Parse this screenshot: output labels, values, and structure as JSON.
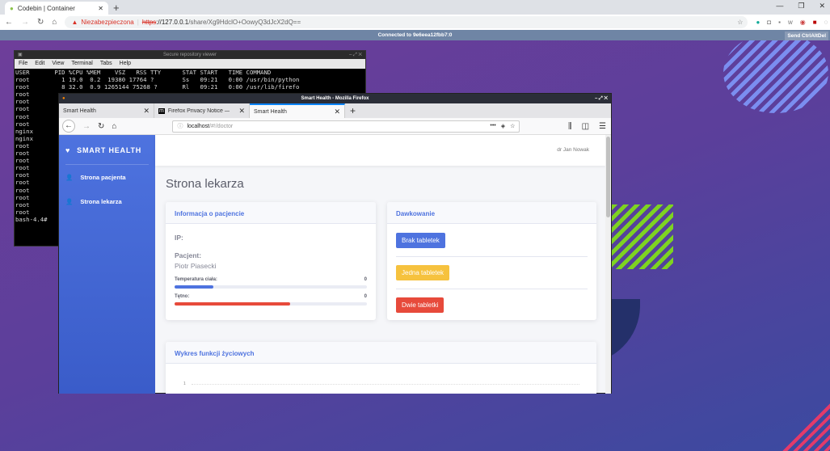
{
  "browser": {
    "tab_title": "Codebin | Container",
    "warning": "Niezabezpieczona",
    "url_scheme": "https",
    "url_host": "://127.0.0.1",
    "url_path": "/share/Xg9HdclO+OowyQ3dJcX2dQ=="
  },
  "vnc": {
    "status": "Connected to 9e6eea12fbb7:0",
    "cad_button": "Send CtrlAltDel"
  },
  "terminal": {
    "title": "Secure repository viewer",
    "menu": [
      "File",
      "Edit",
      "View",
      "Terminal",
      "Tabs",
      "Help"
    ],
    "lines": [
      "USER       PID %CPU %MEM    VSZ   RSS TTY      STAT START   TIME COMMAND",
      "root         1 19.0  0.2  19380 17764 ?        Ss   09:21   0:00 /usr/bin/python",
      "root         8 32.0  0.9 1265144 75268 ?       Rl   09:21   0:00 /usr/lib/firefo",
      "root",
      "root",
      "root",
      "root",
      "root",
      "nginx",
      "nginx",
      "root",
      "root",
      "root",
      "root",
      "root",
      "root",
      "root",
      "root",
      "root",
      "root",
      "bash-4.4# "
    ]
  },
  "firefox": {
    "title": "Smart Health - Mozilla Firefox",
    "tabs": [
      {
        "label": "Smart Health"
      },
      {
        "label": "Firefox Privacy Notice — Mo"
      },
      {
        "label": "Smart Health"
      }
    ],
    "url_host": "localhost",
    "url_path": "/#!/doctor"
  },
  "app": {
    "brand": "SMART HEALTH",
    "nav": [
      {
        "label": "Strona pacjenta"
      },
      {
        "label": "Strona lekarza"
      }
    ],
    "user": "dr Jan Nowak",
    "page_title": "Strona lekarza",
    "patient_card": {
      "title": "Informacja o pacjencie",
      "ip_label": "IP:",
      "patient_label": "Pacjent:",
      "patient_name": "Piotr Piasecki",
      "temp_label": "Temperatura ciała:",
      "temp_value": "0",
      "temp_progress": 20,
      "pulse_label": "Tętno:",
      "pulse_value": "0",
      "pulse_progress": 60
    },
    "dosage_card": {
      "title": "Dawkowanie",
      "buttons": [
        {
          "label": "Brak tabletek",
          "color": "#4e73df"
        },
        {
          "label": "Jedna tabletek",
          "color": "#f6c23e"
        },
        {
          "label": "Dwie tabletki",
          "color": "#e74a3b"
        }
      ]
    },
    "chart_card": {
      "title": "Wykres funkcji życiowych",
      "y_tick": "1"
    }
  }
}
